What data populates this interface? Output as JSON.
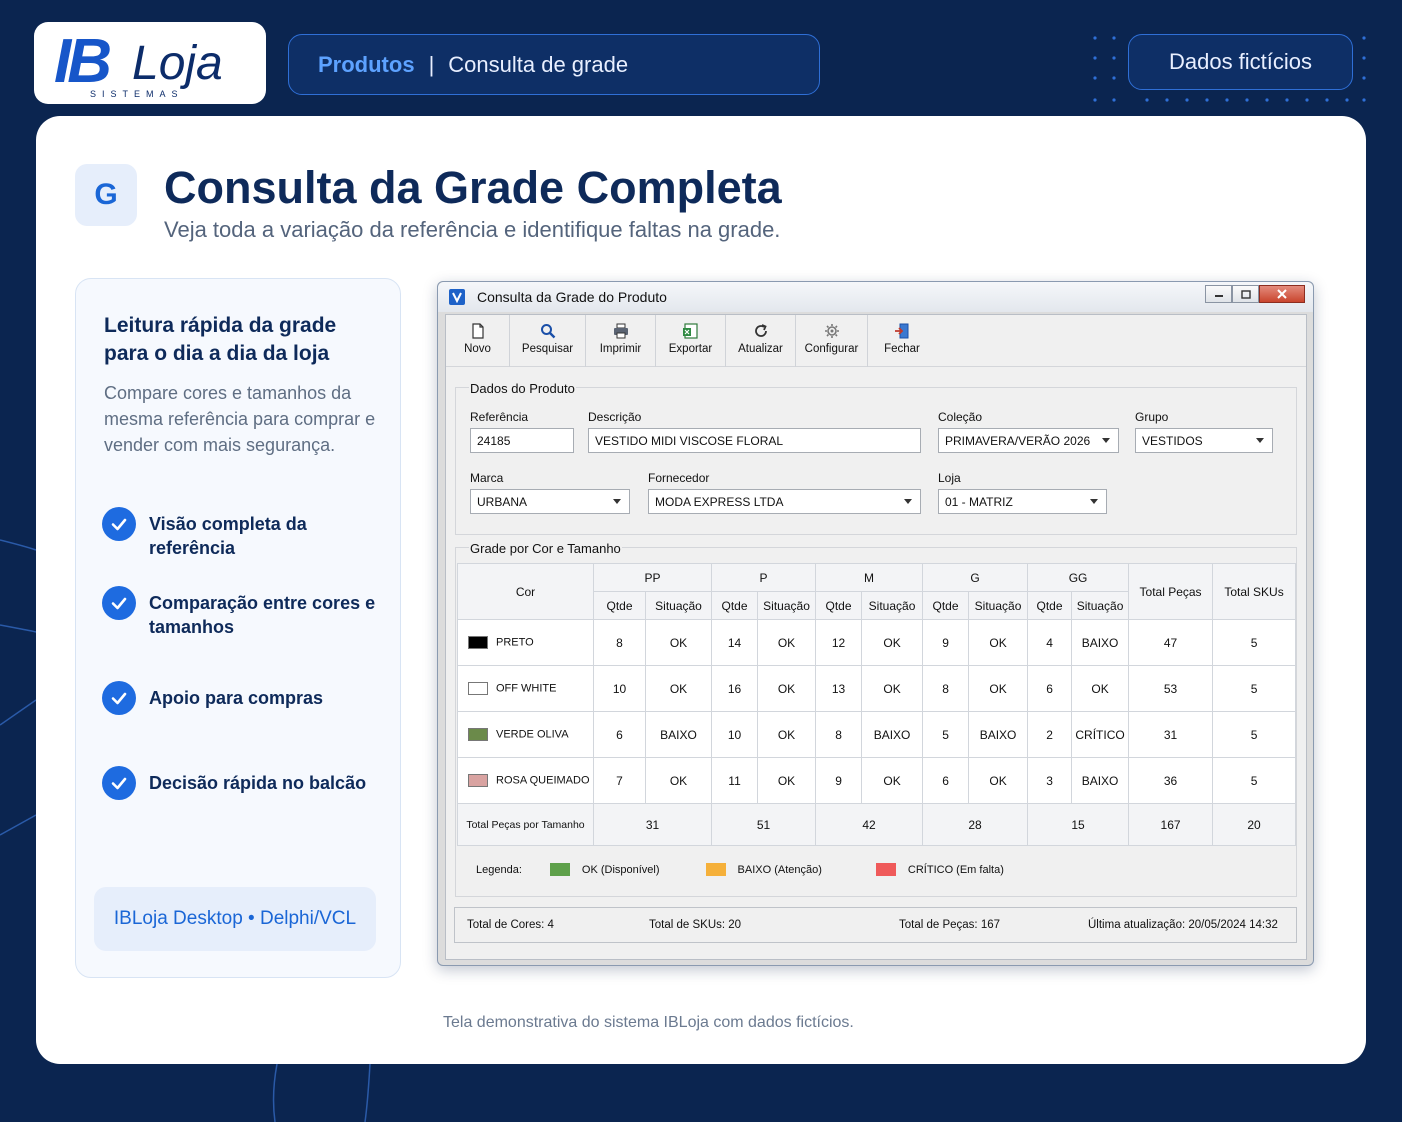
{
  "header": {
    "logo_main": "IB",
    "logo_brand": "Loja",
    "logo_sub": "SISTEMAS",
    "breadcrumb_section": "Produtos",
    "breadcrumb_separator": "|",
    "breadcrumb_page": "Consulta de grade",
    "badge": "Dados fictícios"
  },
  "hero": {
    "icon_letter": "G",
    "title": "Consulta da Grade Completa",
    "subtitle": "Veja toda a variação da referência e identifique faltas na grade."
  },
  "left_panel": {
    "heading": "Leitura rápida da grade para o dia a dia da loja",
    "text": "Compare cores e tamanhos da mesma referência para comprar e vender com mais segurança.",
    "features": [
      "Visão completa da referência",
      "Comparação entre cores e tamanhos",
      "Apoio para compras",
      "Decisão rápida no balcão"
    ],
    "footer": "IBLoja Desktop • Delphi/VCL"
  },
  "window": {
    "title": "Consulta da Grade do Produto",
    "toolbar": [
      "Novo",
      "Pesquisar",
      "Imprimir",
      "Exportar",
      "Atualizar",
      "Configurar",
      "Fechar"
    ],
    "product_group_title": "Dados do Produto",
    "fields": {
      "referencia_label": "Referência",
      "referencia_value": "24185",
      "descricao_label": "Descrição",
      "descricao_value": "VESTIDO MIDI VISCOSE FLORAL",
      "colecao_label": "Coleção",
      "colecao_value": "PRIMAVERA/VERÃO 2026",
      "grupo_label": "Grupo",
      "grupo_value": "VESTIDOS",
      "marca_label": "Marca",
      "marca_value": "URBANA",
      "fornecedor_label": "Fornecedor",
      "fornecedor_value": "MODA EXPRESS LTDA",
      "loja_label": "Loja",
      "loja_value": "01 - MATRIZ"
    },
    "grid_group_title": "Grade por Cor e Tamanho",
    "grid": {
      "col_cor": "Cor",
      "sizes": [
        "PP",
        "P",
        "M",
        "G",
        "GG"
      ],
      "sub_qtde": "Qtde",
      "sub_situacao": "Situação",
      "col_total_pecas": "Total Peças",
      "col_total_skus": "Total SKUs",
      "rows": [
        {
          "cor": "PRETO",
          "swatch": "#000000",
          "c0q": "8",
          "c0s": "OK",
          "c1q": "14",
          "c1s": "OK",
          "c2q": "12",
          "c2s": "OK",
          "c3q": "9",
          "c3s": "OK",
          "c4q": "4",
          "c4s": "BAIXO",
          "total": "47",
          "skus": "5"
        },
        {
          "cor": "OFF WHITE",
          "swatch": "#ffffff",
          "c0q": "10",
          "c0s": "OK",
          "c1q": "16",
          "c1s": "OK",
          "c2q": "13",
          "c2s": "OK",
          "c3q": "8",
          "c3s": "OK",
          "c4q": "6",
          "c4s": "OK",
          "total": "53",
          "skus": "5"
        },
        {
          "cor": "VERDE OLIVA",
          "swatch": "#6b8a4a",
          "c0q": "6",
          "c0s": "BAIXO",
          "c1q": "10",
          "c1s": "OK",
          "c2q": "8",
          "c2s": "BAIXO",
          "c3q": "5",
          "c3s": "BAIXO",
          "c4q": "2",
          "c4s": "CRÍTICO",
          "total": "31",
          "skus": "5"
        },
        {
          "cor": "ROSA QUEIMADO",
          "swatch": "#d9a3a1",
          "c0q": "7",
          "c0s": "OK",
          "c1q": "11",
          "c1s": "OK",
          "c2q": "9",
          "c2s": "OK",
          "c3q": "6",
          "c3s": "OK",
          "c4q": "3",
          "c4s": "BAIXO",
          "total": "36",
          "skus": "5"
        }
      ],
      "totals_label": "Total Peças por Tamanho",
      "totals": [
        "31",
        "51",
        "42",
        "28",
        "15",
        "167",
        "20"
      ]
    },
    "legend": {
      "label": "Legenda:",
      "items": [
        {
          "text": "OK (Disponível)",
          "color": "#5ea04a"
        },
        {
          "text": "BAIXO (Atenção)",
          "color": "#f5b03a"
        },
        {
          "text": "CRÍTICO (Em falta)",
          "color": "#ef5a5a"
        }
      ]
    },
    "status": {
      "cores": "Total de Cores:  4",
      "skus": "Total de SKUs:  20",
      "pecas": "Total de Peças:  167",
      "atualizacao": "Última atualização:  20/05/2024 14:32"
    }
  },
  "footnote": "Tela demonstrativa do sistema IBLoja com dados fictícios.",
  "colors": {
    "accent": "#1e6be0",
    "background": "#0b2550",
    "ok": "#2f9a27",
    "baixo": "#e89a0b",
    "critico": "#e02424"
  }
}
